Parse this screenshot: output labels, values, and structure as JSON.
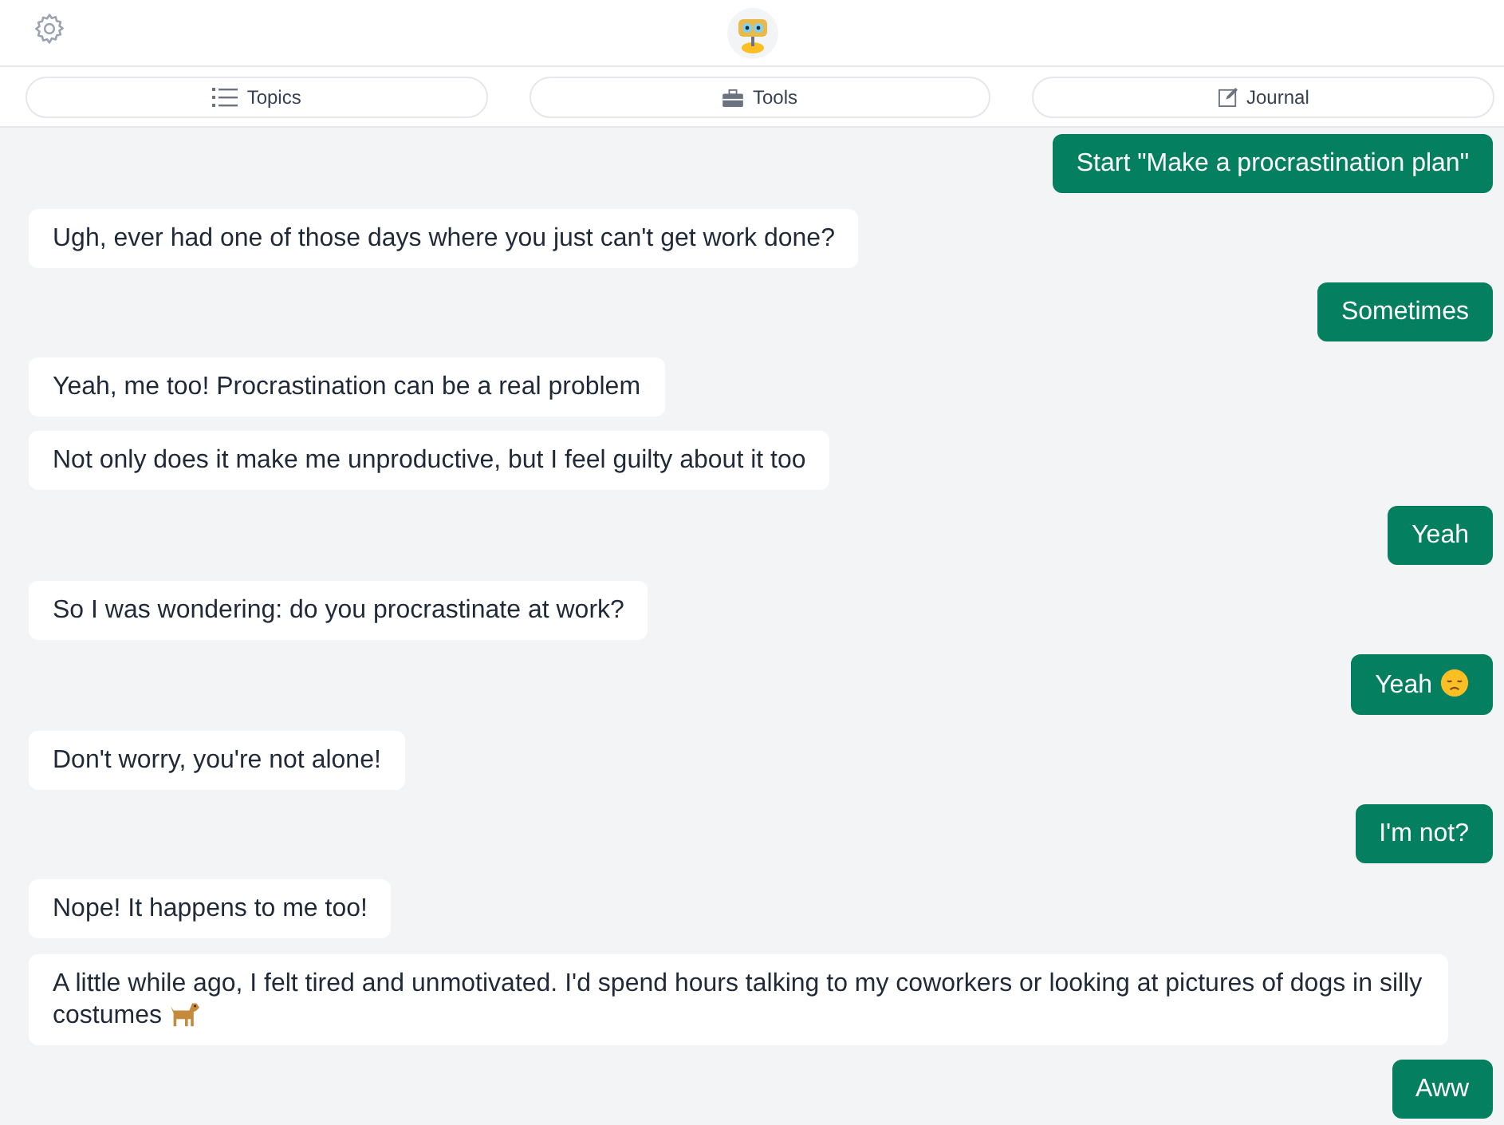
{
  "tabs": [
    {
      "label": "Topics",
      "kind": "list"
    },
    {
      "label": "Tools",
      "kind": "toolbox"
    },
    {
      "label": "Journal",
      "kind": "edit"
    }
  ],
  "messages": [
    {
      "kind": "user",
      "text": "Start \"Make a procrastination plan\""
    },
    {
      "kind": "bot",
      "text": "Ugh, ever had one of those days where you just can't get work done?"
    },
    {
      "kind": "user",
      "text": "Sometimes"
    },
    {
      "kind": "bot",
      "text": "Yeah, me too! Procrastination can be a real problem"
    },
    {
      "kind": "bot",
      "text": "Not only does it make me unproductive, but I feel guilty about it too"
    },
    {
      "kind": "user",
      "text": "Yeah"
    },
    {
      "kind": "bot",
      "text": "So I was wondering: do you procrastinate at work?"
    },
    {
      "kind": "user",
      "text": "Yeah",
      "emoji": {
        "kind": "sad"
      }
    },
    {
      "kind": "bot",
      "text": "Don't worry, you're not alone!"
    },
    {
      "kind": "user",
      "text": "I'm not?"
    },
    {
      "kind": "bot",
      "text": "Nope! It happens to me too!"
    },
    {
      "kind": "bot",
      "text": "A little while ago, I felt tired and unmotivated. I'd spend hours talking to my coworkers or looking at pictures of dogs in silly costumes",
      "emoji": {
        "kind": "dog"
      }
    },
    {
      "kind": "user",
      "text": "Aww"
    }
  ]
}
